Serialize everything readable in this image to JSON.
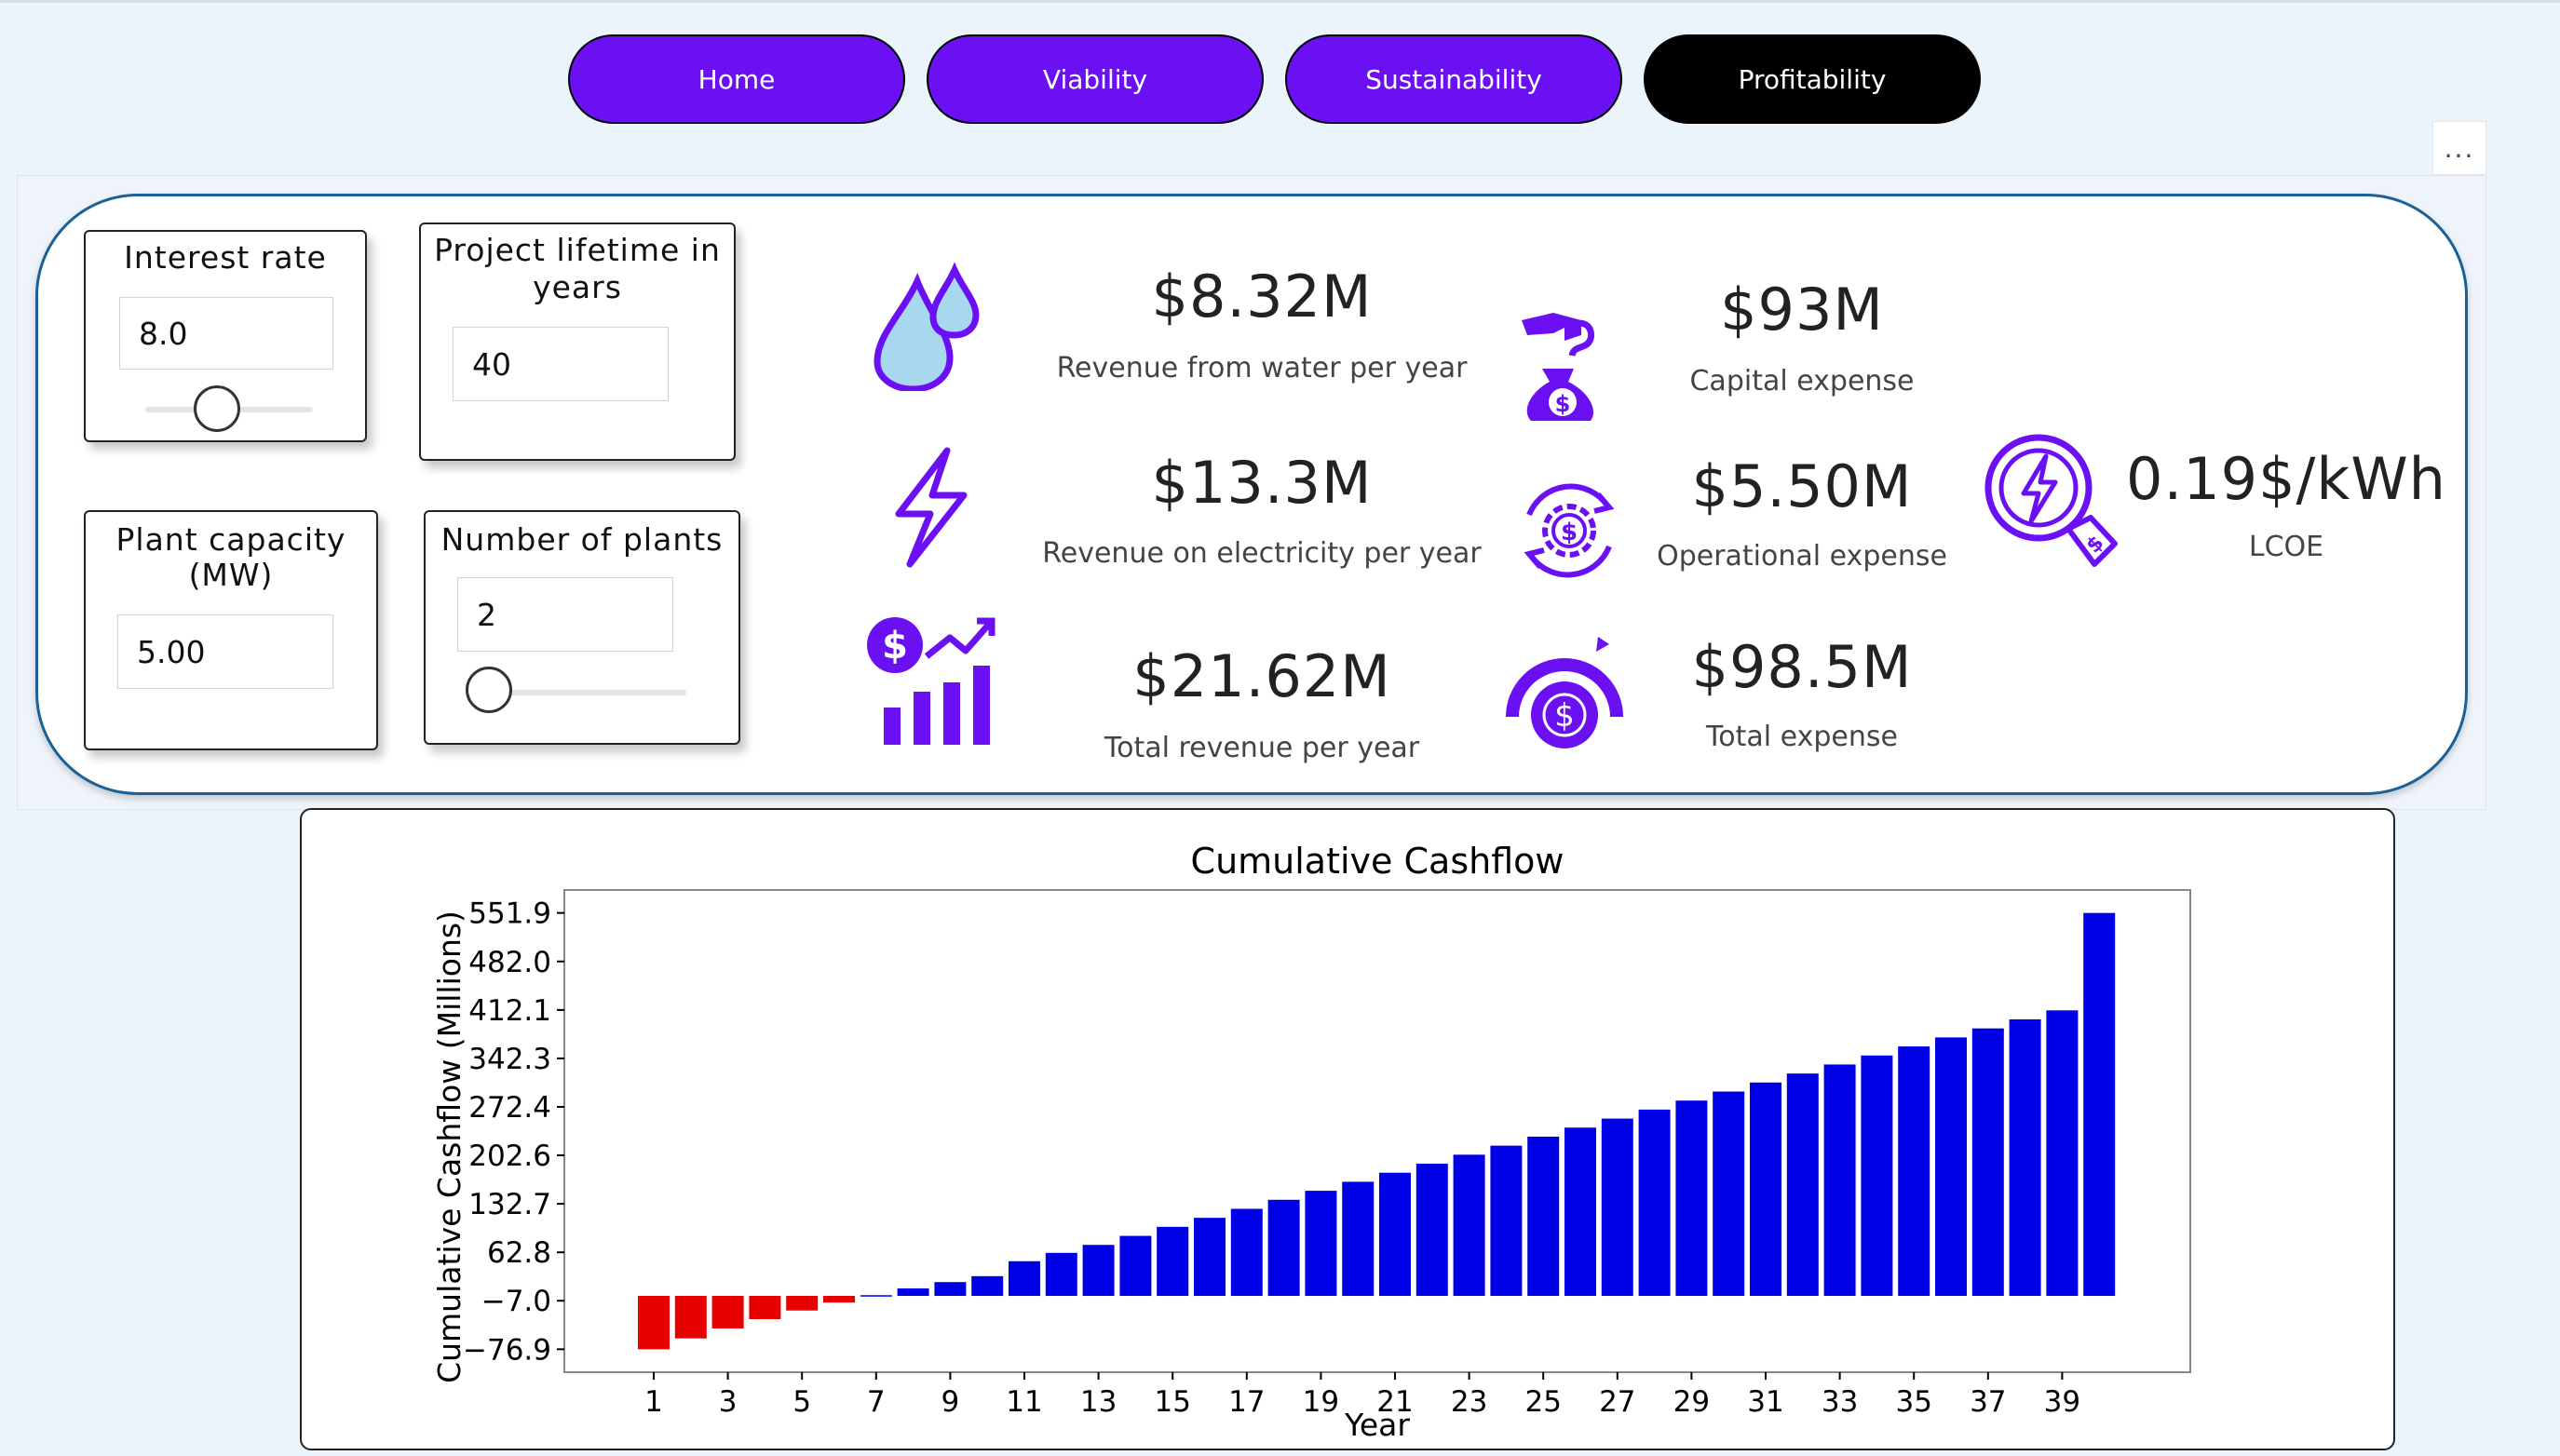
{
  "nav": {
    "home": "Home",
    "viability": "Viability",
    "sustainability": "Sustainability",
    "profitability": "Profitability"
  },
  "more_label": "...",
  "controls": {
    "interest_rate": {
      "title": "Interest rate",
      "value": "8.0"
    },
    "project_lifetime": {
      "title_line1": "Project lifetime in",
      "title_line2": "years",
      "value": "40"
    },
    "plant_capacity": {
      "title_line1": "Plant capacity",
      "title_line2": "(MW)",
      "value": "5.00"
    },
    "number_of_plants": {
      "title": "Number of plants",
      "value": "2"
    }
  },
  "kpis": {
    "revenue_water": {
      "value": "$8.32M",
      "label": "Revenue from water per year"
    },
    "revenue_electricity": {
      "value": "$13.3M",
      "label": "Revenue on electricity per year"
    },
    "total_revenue": {
      "value": "$21.62M",
      "label": "Total revenue per year"
    },
    "capital_expense": {
      "value": "$93M",
      "label": "Capital expense"
    },
    "operational_expense": {
      "value": "$5.50M",
      "label": "Operational expense"
    },
    "total_expense": {
      "value": "$98.5M",
      "label": "Total expense"
    },
    "lcoe": {
      "value": "0.19$/kWh",
      "label": "LCOE"
    }
  },
  "icons": {
    "revenue_water": "water-drops-icon",
    "revenue_electricity": "lightning-icon",
    "total_revenue": "revenue-growth-icon",
    "capital_expense": "money-bag-hand-icon",
    "operational_expense": "gear-dollar-cycle-icon",
    "total_expense": "dollar-gauge-icon",
    "lcoe": "energy-price-tag-icon"
  },
  "colors": {
    "accent": "#6a10f2",
    "active_nav": "#000000",
    "panel_border": "#1b6096",
    "bar_positive": "#0000e6",
    "bar_negative": "#e60000"
  },
  "chart_data": {
    "type": "bar",
    "title": "Cumulative Cashflow",
    "xlabel": "Year",
    "ylabel": "Cumulative Cashflow (Millions)",
    "x": [
      1,
      2,
      3,
      4,
      5,
      6,
      7,
      8,
      9,
      10,
      11,
      12,
      13,
      14,
      15,
      16,
      17,
      18,
      19,
      20,
      21,
      22,
      23,
      24,
      25,
      26,
      27,
      28,
      29,
      30,
      31,
      32,
      33,
      34,
      35,
      36,
      37,
      38,
      39,
      40
    ],
    "values": [
      -76.9,
      -61.3,
      -46.9,
      -33.5,
      -21.1,
      -9.6,
      1.0,
      10.8,
      19.9,
      28.4,
      50.0,
      62.0,
      73.5,
      86.5,
      99.5,
      112.5,
      125.5,
      138.5,
      151.5,
      164.5,
      177.5,
      190.5,
      203.5,
      216.5,
      229.5,
      242.5,
      255.5,
      268.5,
      281.5,
      294.5,
      307.5,
      320.5,
      333.5,
      346.5,
      359.5,
      372.5,
      385.5,
      398.5,
      411.5,
      551.9
    ],
    "yticks": [
      "551.9",
      "482.0",
      "412.1",
      "342.3",
      "272.4",
      "202.6",
      "132.7",
      "62.8",
      "−7.0",
      "−76.9"
    ],
    "ytick_values": [
      551.9,
      482.0,
      412.1,
      342.3,
      272.4,
      202.6,
      132.7,
      62.8,
      -7.0,
      -76.9
    ],
    "xticks": [
      "1",
      "3",
      "5",
      "7",
      "9",
      "11",
      "13",
      "15",
      "17",
      "19",
      "21",
      "23",
      "25",
      "27",
      "29",
      "31",
      "33",
      "35",
      "37",
      "39"
    ],
    "ylim": [
      -110,
      585
    ],
    "negative_color": "#e60000",
    "positive_color": "#0000e6"
  }
}
